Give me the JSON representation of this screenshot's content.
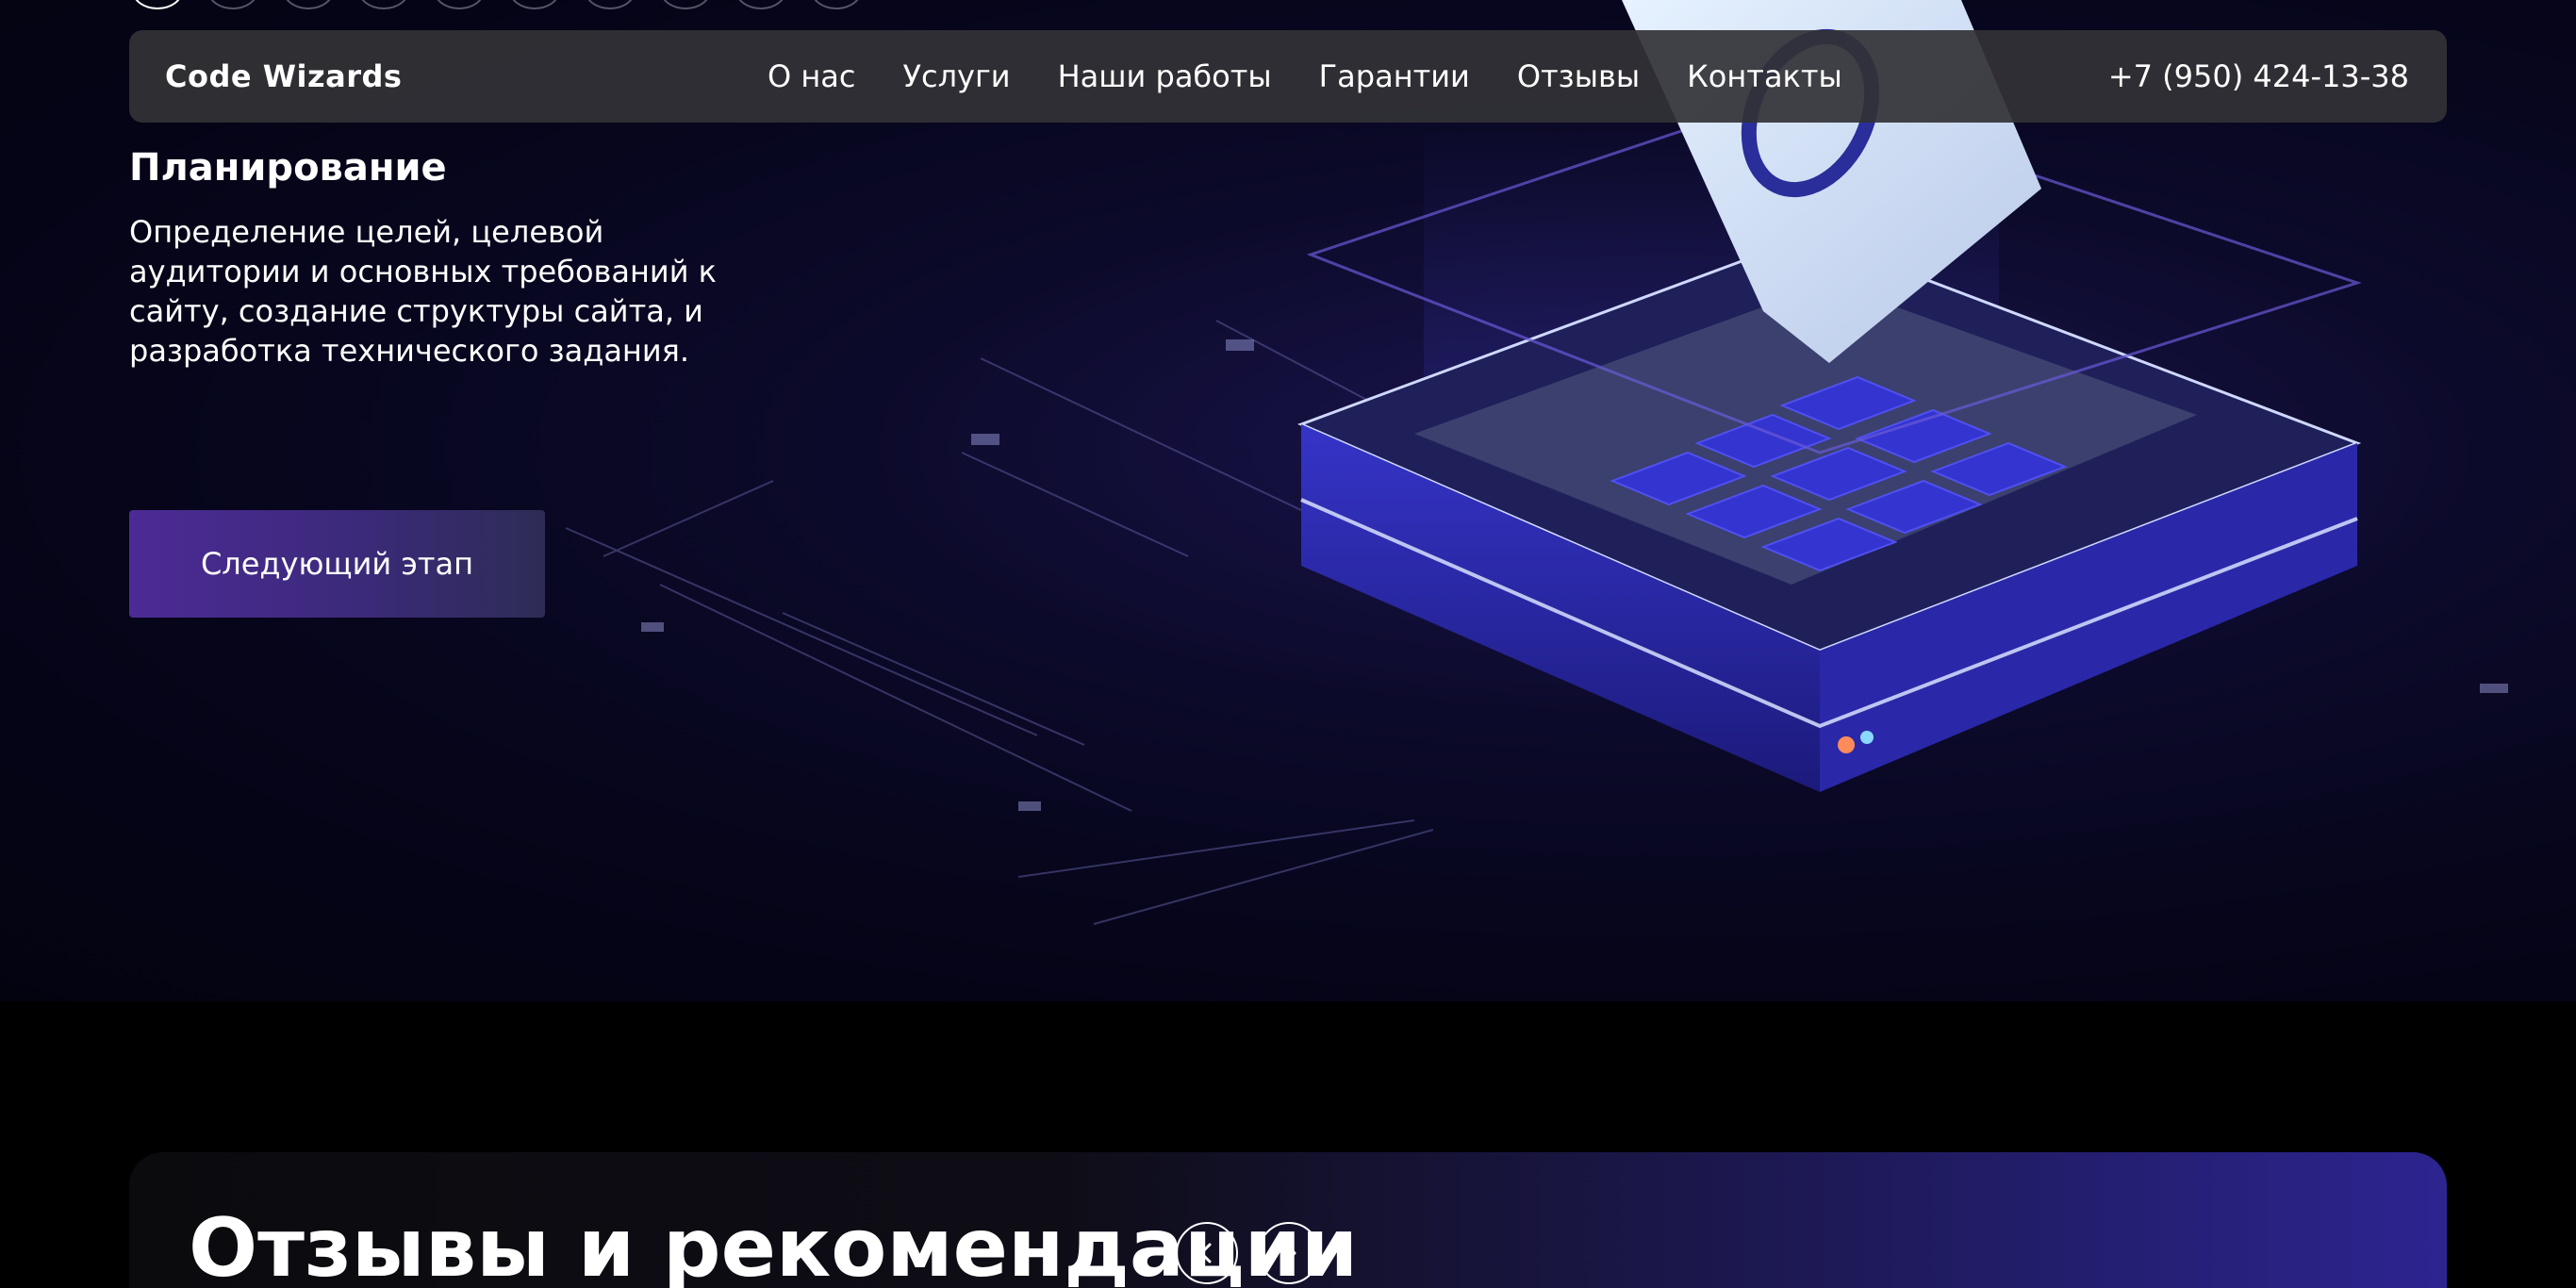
{
  "header": {
    "logo": "Code Wizards",
    "nav": [
      "О нас",
      "Услуги",
      "Наши работы",
      "Гарантии",
      "Отзывы",
      "Контакты"
    ],
    "phone": "+7 (950) 424-13-38"
  },
  "stage": {
    "title": "Планирование",
    "description": "Определение целей, целевой аудитории и основных требований к сайту, создание структуры сайта, и разработка технического задания.",
    "button": "Следующий этап"
  },
  "reviews": {
    "title": "Отзывы и рекомендации",
    "prev_icon": "chevron-left-icon",
    "next_icon": "chevron-right-icon"
  }
}
